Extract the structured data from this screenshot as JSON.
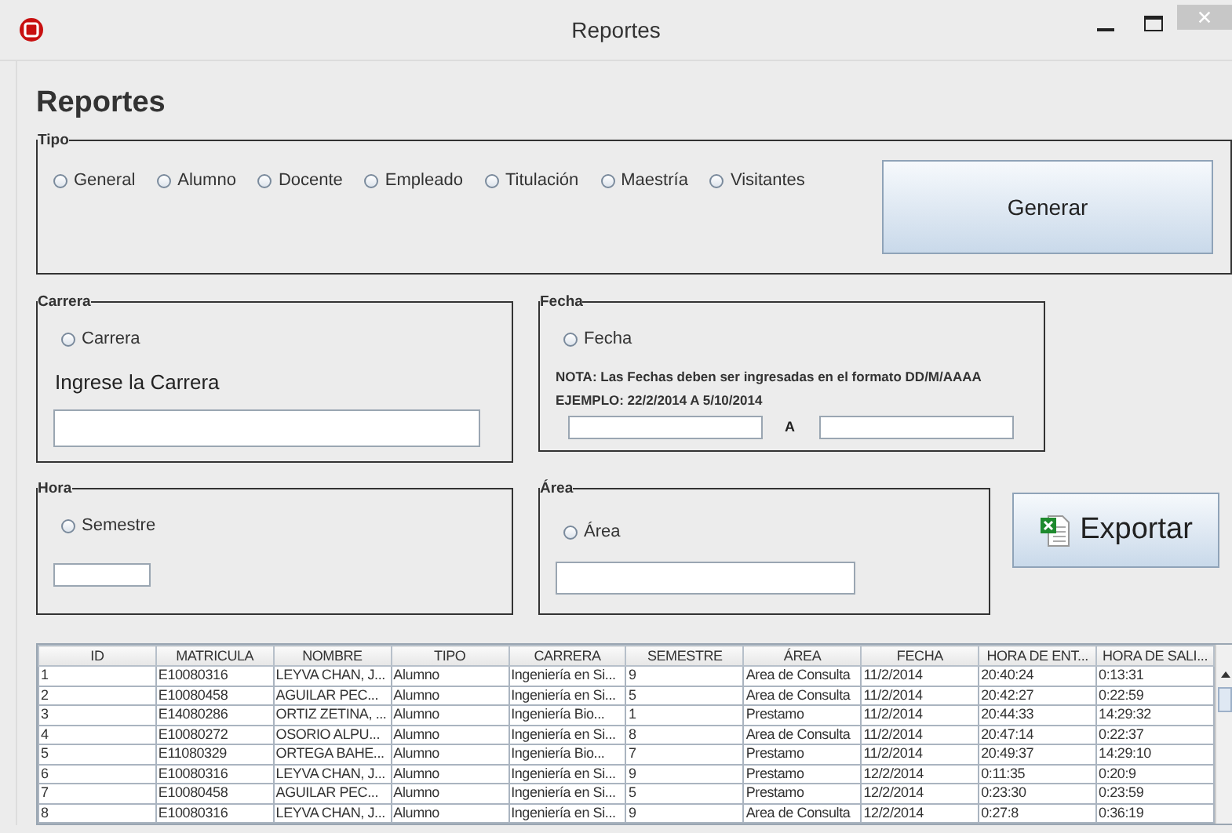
{
  "window": {
    "title": "Reportes"
  },
  "heading": "Reportes",
  "tipo": {
    "legend": "Tipo",
    "options": [
      {
        "label": "General",
        "selected": false
      },
      {
        "label": "Alumno",
        "selected": false
      },
      {
        "label": "Docente",
        "selected": false
      },
      {
        "label": "Empleado",
        "selected": false
      },
      {
        "label": "Titulación",
        "selected": false
      },
      {
        "label": "Maestría",
        "selected": false
      },
      {
        "label": "Visitantes",
        "selected": false
      }
    ],
    "button": "Generar"
  },
  "carrera": {
    "legend": "Carrera",
    "radio": {
      "label": "Carrera",
      "selected": false
    },
    "prompt": "Ingrese la Carrera"
  },
  "fecha": {
    "legend": "Fecha",
    "radio": {
      "label": "Fecha",
      "selected": false
    },
    "note": "NOTA: Las Fechas deben ser ingresadas en el formato DD/M/AAAA",
    "example": "EJEMPLO: 22/2/2014 A 5/10/2014",
    "separator": "A"
  },
  "hora": {
    "legend": "Hora",
    "radio": {
      "label": "Semestre",
      "selected": false
    }
  },
  "area": {
    "legend": "Área",
    "radio": {
      "label": "Área",
      "selected": false
    }
  },
  "export_button": "Exportar",
  "table": {
    "columns": [
      "ID",
      "MATRICULA",
      "NOMBRE",
      "TIPO",
      "CARRERA",
      "SEMESTRE",
      "ÁREA",
      "FECHA",
      "HORA DE ENT...",
      "HORA DE SALI..."
    ],
    "rows": [
      [
        "1",
        "E10080316",
        "LEYVA CHAN, J...",
        "Alumno",
        "Ingeniería en Si...",
        "9",
        "Area de Consulta",
        "11/2/2014",
        "20:40:24",
        "0:13:31"
      ],
      [
        "2",
        "E10080458",
        "AGUILAR PEC...",
        "Alumno",
        "Ingeniería en Si...",
        "5",
        "Area de Consulta",
        "11/2/2014",
        "20:42:27",
        "0:22:59"
      ],
      [
        "3",
        "E14080286",
        "ORTIZ ZETINA, ...",
        "Alumno",
        "Ingeniería Bio...",
        "1",
        "Prestamo",
        "11/2/2014",
        "20:44:33",
        "14:29:32"
      ],
      [
        "4",
        "E10080272",
        "OSORIO ALPU...",
        "Alumno",
        "Ingeniería en Si...",
        "8",
        "Area de Consulta",
        "11/2/2014",
        "20:47:14",
        "0:22:37"
      ],
      [
        "5",
        "E11080329",
        "ORTEGA BAHE...",
        "Alumno",
        "Ingeniería Bio...",
        "7",
        "Prestamo",
        "11/2/2014",
        "20:49:37",
        "14:29:10"
      ],
      [
        "6",
        "E10080316",
        "LEYVA CHAN, J...",
        "Alumno",
        "Ingeniería en Si...",
        "9",
        "Prestamo",
        "12/2/2014",
        "0:11:35",
        "0:20:9"
      ],
      [
        "7",
        "E10080458",
        "AGUILAR PEC...",
        "Alumno",
        "Ingeniería en Si...",
        "5",
        "Prestamo",
        "12/2/2014",
        "0:23:30",
        "0:23:59"
      ],
      [
        "8",
        "E10080316",
        "LEYVA CHAN, J...",
        "Alumno",
        "Ingeniería en Si...",
        "9",
        "Area de Consulta",
        "12/2/2014",
        "0:27:8",
        "0:36:19"
      ]
    ]
  }
}
